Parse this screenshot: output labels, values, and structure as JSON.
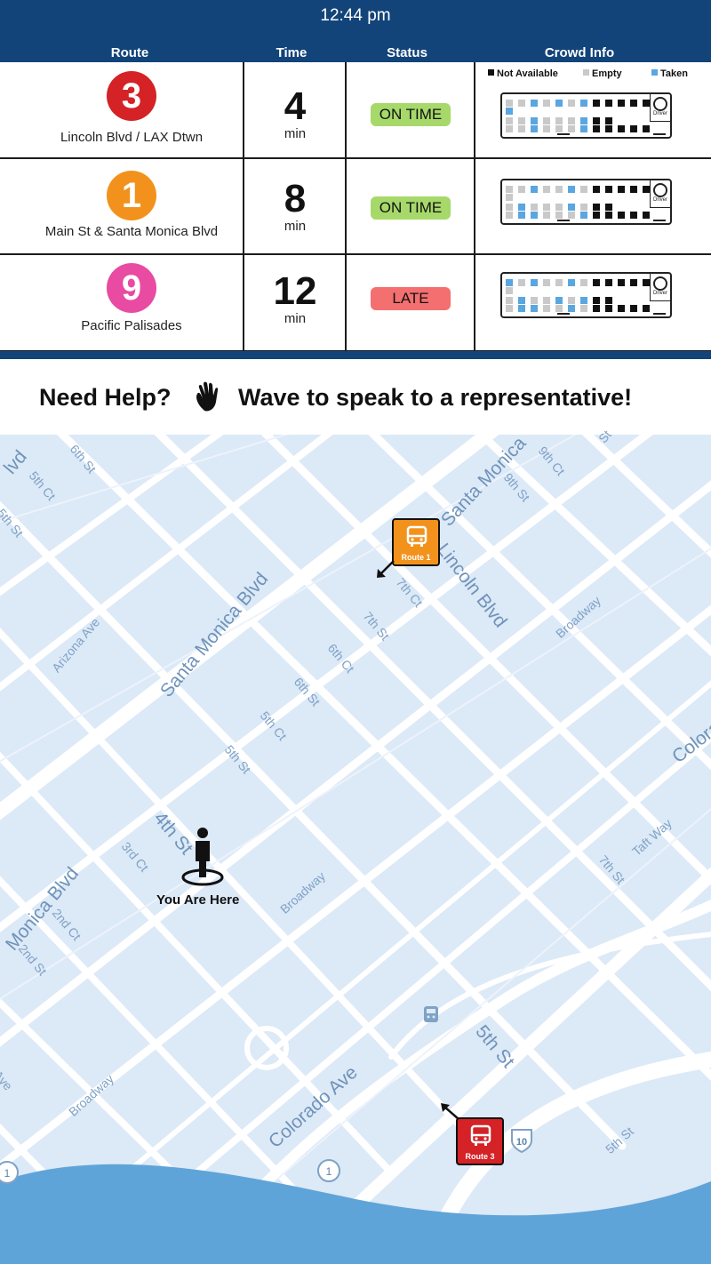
{
  "header": {
    "time": "12:44 pm"
  },
  "columns": {
    "route": "Route",
    "time": "Time",
    "status": "Status",
    "crowd": "Crowd Info"
  },
  "legend": {
    "not_available": "Not Available",
    "empty": "Empty",
    "taken": "Taken"
  },
  "routes": [
    {
      "number": "3",
      "name": "Lincoln Blvd / LAX Dtwn",
      "minutes": "4",
      "unit": "min",
      "status": "ON TIME",
      "color": "#d42226"
    },
    {
      "number": "1",
      "name": "Main St & Santa Monica Blvd",
      "minutes": "8",
      "unit": "min",
      "status": "ON TIME",
      "color": "#f2921c"
    },
    {
      "number": "9",
      "name": "Pacific Palisades",
      "minutes": "12",
      "unit": "min",
      "status": "LATE",
      "color": "#e94aa2"
    }
  ],
  "driver_label": "Driver",
  "help": {
    "lead": "Need Help?",
    "message": "Wave to speak to a representative!"
  },
  "map": {
    "you_are_here": "You Are Here",
    "markers": {
      "route1": "Route 1",
      "route3": "Route 3"
    },
    "interstate": "10",
    "route_shield": "1",
    "streets": {
      "santa_monica_blvd": "Santa Monica Blvd",
      "santa_monica_top": "Santa Monica",
      "monica_blvd": "Monica Blvd",
      "lincoln_blvd": "Lincoln Blvd",
      "colorado_ave": "Colorado Ave",
      "colorado": "Colora",
      "broadway_top": "Broadway",
      "broadway_mid": "Broadway",
      "broadway_low": "Broadway",
      "arizona_ave": "Arizona Ave",
      "taft_way": "Taft Way",
      "sixth_st_top": "6th St",
      "fifth_ct_top": "5th Ct",
      "fifth_st_left": "5th St",
      "ninth_ct": "9th Ct",
      "ninth_st": "9th St",
      "seventh_ct": "7th Ct",
      "seventh_st": "7th St",
      "sixth_ct": "6th Ct",
      "sixth_st": "6th St",
      "fifth_ct": "5th Ct",
      "fifth_st": "5th St",
      "fourth_st": "4th St",
      "third_ct": "3rd Ct",
      "second_ct": "2nd Ct",
      "second_st": "2nd St",
      "seventh_st_right": "7th St",
      "fifth_st_low": "5th St",
      "fifth_st_corner": "5th St",
      "blvd_fragment": "lvd",
      "st_fragment": "St",
      "ave_fragment": "Ave"
    }
  },
  "colors": {
    "navy": "#12447a",
    "map_bg": "#dce9f7",
    "roads": "#ffffff",
    "water": "#5fa4d8",
    "taken": "#5aa6e0",
    "empty": "#c9c9c9",
    "not_available": "#111111"
  }
}
